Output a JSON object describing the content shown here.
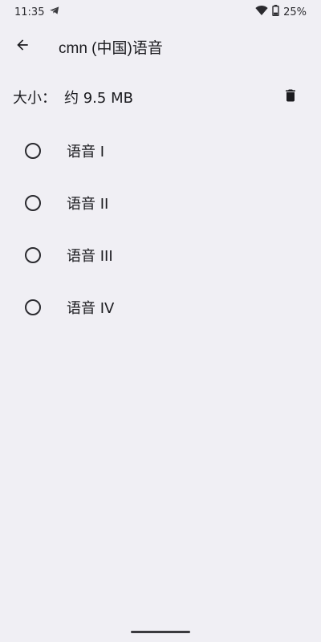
{
  "status_bar": {
    "time": "11:35",
    "battery": "25%",
    "icons": [
      "telegram-icon",
      "wifi-icon",
      "battery-icon"
    ]
  },
  "app_bar": {
    "title": "cmn (中国)语音",
    "back_icon": "arrow-back-icon"
  },
  "size_row": {
    "label": "大小：",
    "value": "约 9.5 MB",
    "delete_icon": "trash-icon"
  },
  "voices": [
    {
      "label": "语音 I",
      "selected": false
    },
    {
      "label": "语音 II",
      "selected": false
    },
    {
      "label": "语音 III",
      "selected": false
    },
    {
      "label": "语音 IV",
      "selected": false
    }
  ],
  "colors": {
    "background": "#f0eff4",
    "text": "#1b1b1f"
  }
}
